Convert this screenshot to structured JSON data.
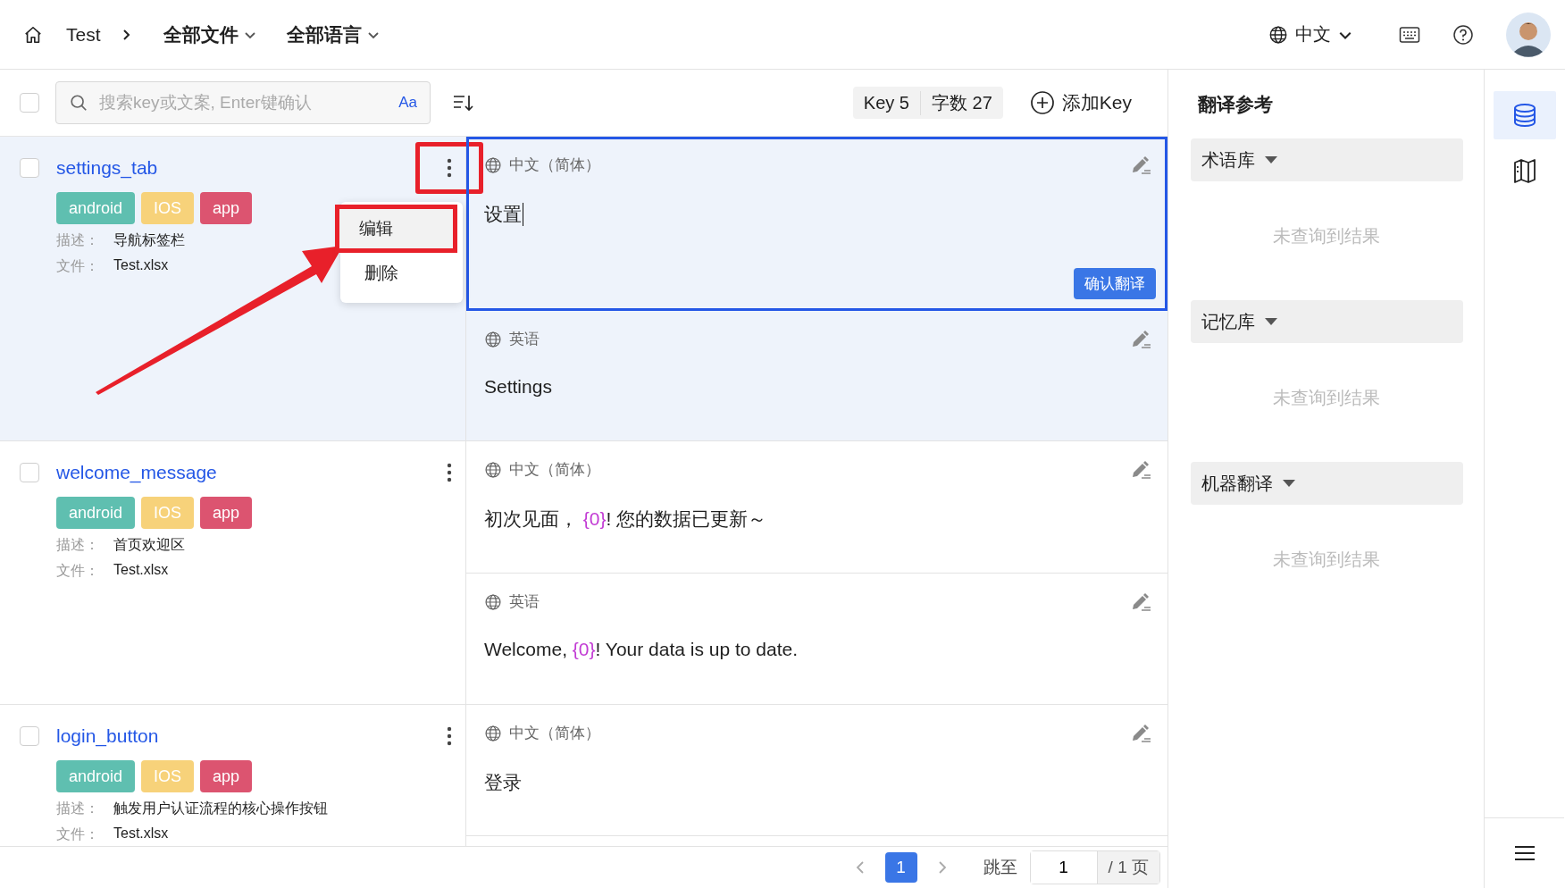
{
  "topbar": {
    "breadcrumb": "Test",
    "file_filter": "全部文件",
    "language_filter": "全部语言",
    "ui_language": "中文"
  },
  "toolbar": {
    "select_all_checked": false,
    "search_placeholder": "搜索key或文案, Enter键确认",
    "case_toggle": "Aa",
    "key_count": "Key 5",
    "word_count": "字数 27",
    "add_key": "添加Key"
  },
  "keys": [
    {
      "name": "settings_tab",
      "checked": false,
      "selected": true,
      "menu_open": true,
      "tags": [
        {
          "label": "android",
          "color": "#5fbfb0"
        },
        {
          "label": "IOS",
          "color": "#f7d27a"
        },
        {
          "label": "app",
          "color": "#dc5470"
        }
      ],
      "description_label": "描述：",
      "description": "导航标签栏",
      "file_label": "文件：",
      "file": "Test.xlsx",
      "translations": [
        {
          "language": "中文（简体）",
          "editing": true,
          "confirm": "确认翻译",
          "segments": [
            {
              "kind": "text",
              "text": "设置"
            }
          ]
        },
        {
          "language": "英语",
          "editing": false,
          "segments": [
            {
              "kind": "text",
              "text": "Settings"
            }
          ]
        }
      ]
    },
    {
      "name": "welcome_message",
      "checked": false,
      "selected": false,
      "menu_open": false,
      "tags": [
        {
          "label": "android",
          "color": "#5fbfb0"
        },
        {
          "label": "IOS",
          "color": "#f7d27a"
        },
        {
          "label": "app",
          "color": "#dc5470"
        }
      ],
      "description_label": "描述：",
      "description": "首页欢迎区",
      "file_label": "文件：",
      "file": "Test.xlsx",
      "translations": [
        {
          "language": "中文（简体）",
          "editing": false,
          "segments": [
            {
              "kind": "text",
              "text": "初次见面， "
            },
            {
              "kind": "placeholder",
              "text": "{0}"
            },
            {
              "kind": "text",
              "text": "! 您的数据已更新～"
            }
          ]
        },
        {
          "language": "英语",
          "editing": false,
          "segments": [
            {
              "kind": "text",
              "text": "Welcome, "
            },
            {
              "kind": "placeholder",
              "text": "{0}"
            },
            {
              "kind": "text",
              "text": "! Your data is up to date."
            }
          ]
        }
      ]
    },
    {
      "name": "login_button",
      "checked": false,
      "selected": false,
      "menu_open": false,
      "tags": [
        {
          "label": "android",
          "color": "#5fbfb0"
        },
        {
          "label": "IOS",
          "color": "#f7d27a"
        },
        {
          "label": "app",
          "color": "#dc5470"
        }
      ],
      "description_label": "描述：",
      "description": "触发用户认证流程的核心操作按钮",
      "file_label": "文件：",
      "file": "Test.xlsx",
      "translations": [
        {
          "language": "中文（简体）",
          "editing": false,
          "segments": [
            {
              "kind": "text",
              "text": "登录"
            }
          ]
        }
      ]
    }
  ],
  "context_menu": [
    {
      "label": "编辑",
      "selected": true
    },
    {
      "label": "删除",
      "selected": false
    }
  ],
  "pager": {
    "current": "1",
    "jump_label": "跳至",
    "jump_value": "1",
    "total": "/ 1 页"
  },
  "reference": {
    "title": "翻译参考",
    "sections": [
      {
        "label": "术语库",
        "empty": "未查询到结果"
      },
      {
        "label": "记忆库",
        "empty": "未查询到结果"
      },
      {
        "label": "机器翻译",
        "empty": "未查询到结果"
      }
    ]
  },
  "rail": [
    {
      "kind": "database",
      "selected": true
    },
    {
      "kind": "map",
      "selected": false
    }
  ]
}
